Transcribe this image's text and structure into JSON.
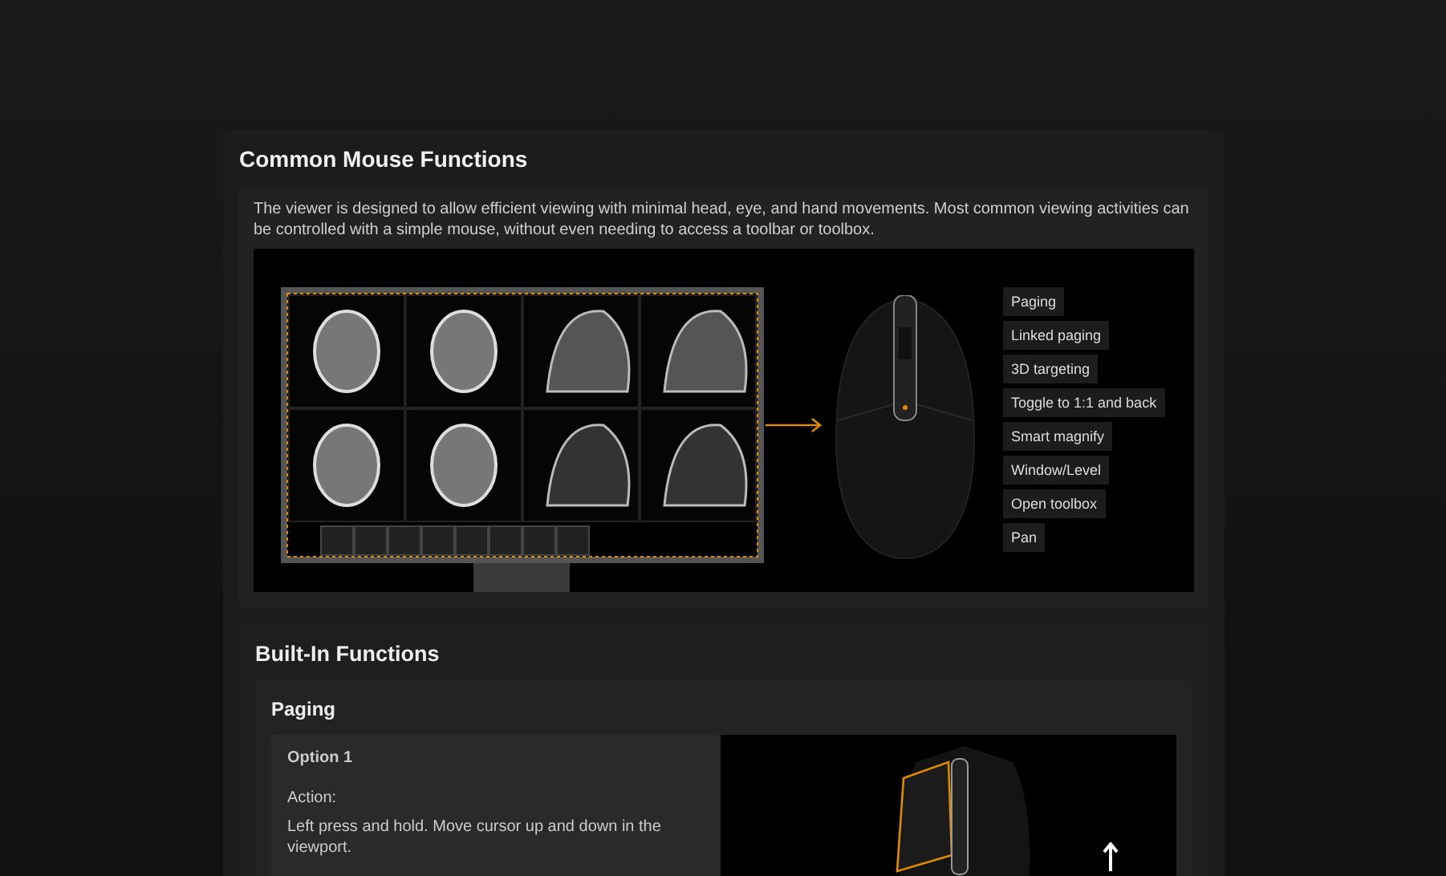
{
  "section": {
    "title": "Common Mouse Functions",
    "description": "The viewer is designed to allow efficient viewing with minimal head, eye, and hand movements. Most common viewing activities can be controlled with a simple mouse, without even needing to access a toolbar or toolbox.",
    "functions": [
      "Paging",
      "Linked paging",
      "3D targeting",
      "Toggle to 1:1 and back",
      "Smart magnify",
      "Window/Level",
      "Open toolbox",
      "Pan"
    ]
  },
  "built_in": {
    "title": "Built-In Functions",
    "groups": [
      {
        "title": "Paging",
        "options": [
          {
            "title": "Option 1",
            "action_label": "Action:",
            "action": "Left press and hold. Move cursor up and down in the viewport."
          }
        ]
      }
    ]
  }
}
